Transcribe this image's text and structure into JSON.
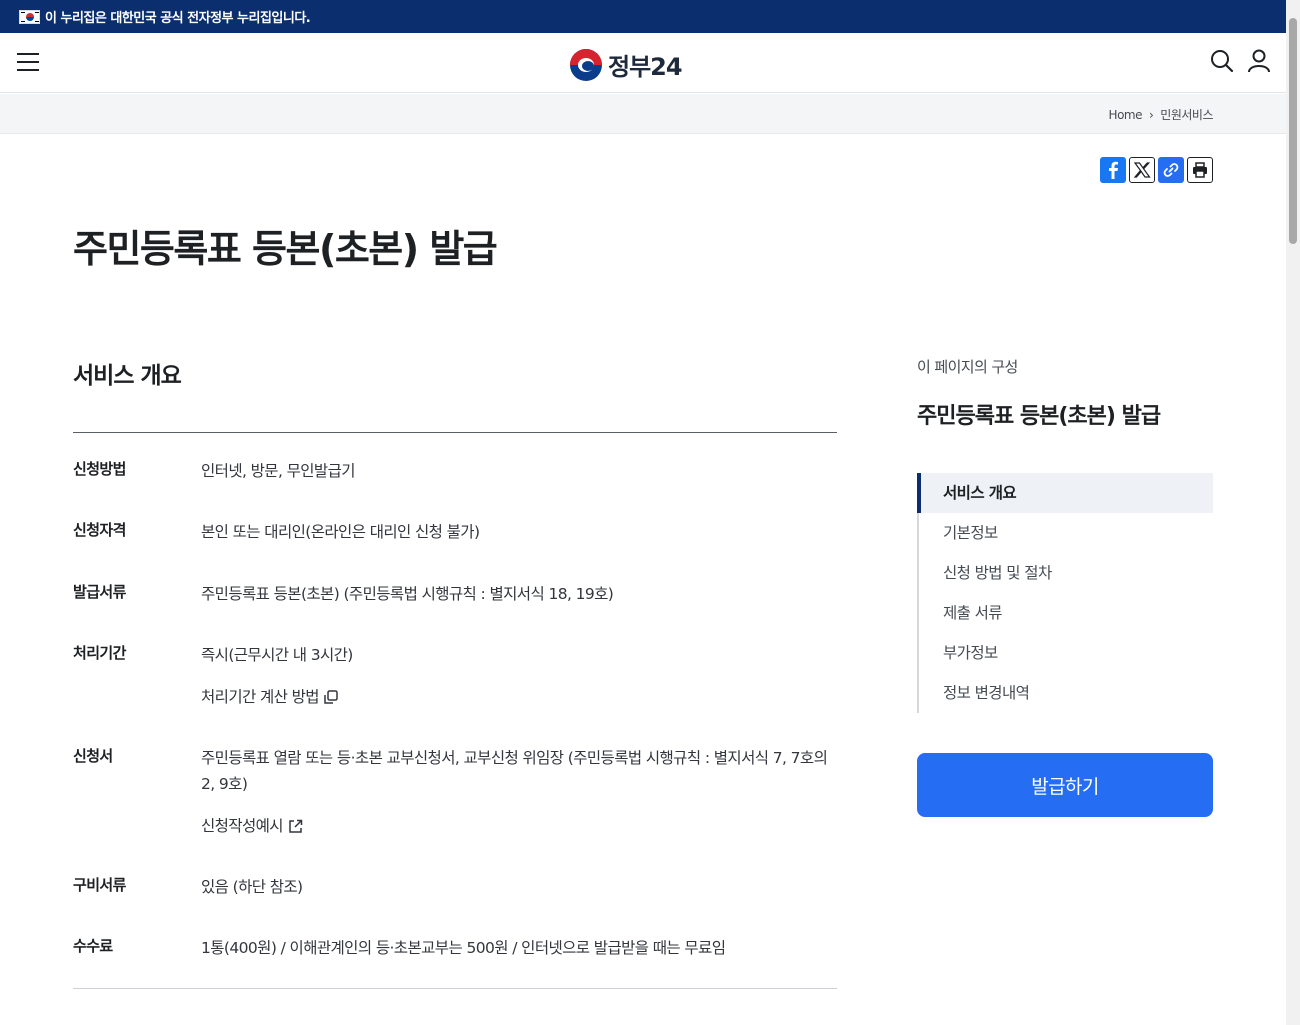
{
  "banner": {
    "text": "이 누리집은 대한민국 공식 전자정부 누리집입니다."
  },
  "header": {
    "logo_text": "정부24"
  },
  "breadcrumb": {
    "home": "Home",
    "separator": "›",
    "current": "민원서비스"
  },
  "page": {
    "title": "주민등록표 등본(초본) 발급"
  },
  "overview": {
    "title": "서비스 개요",
    "rows": [
      {
        "label": "신청방법",
        "values": [
          "인터넷, 방문, 무인발급기"
        ]
      },
      {
        "label": "신청자격",
        "values": [
          "본인 또는 대리인(온라인은 대리인 신청 불가)"
        ]
      },
      {
        "label": "발급서류",
        "values": [
          "주민등록표 등본(초본) (주민등록법 시행규칙 : 별지서식 18, 19호)"
        ]
      },
      {
        "label": "처리기간",
        "values": [
          "즉시(근무시간 내 3시간)"
        ],
        "link": "처리기간 계산 방법"
      },
      {
        "label": "신청서",
        "values": [
          "주민등록표 열람 또는 등·초본 교부신청서, 교부신청 위임장 (주민등록법 시행규칙 : 별지서식 7, 7호의2, 9호)"
        ],
        "link": "신청작성예시"
      },
      {
        "label": "구비서류",
        "values": [
          "있음 (하단 참조)"
        ]
      },
      {
        "label": "수수료",
        "values": [
          "1통(400원) / 이해관계인의 등·초본교부는 500원 / 인터넷으로 발급받을 때는 무료임"
        ]
      }
    ]
  },
  "toc": {
    "caption": "이 페이지의 구성",
    "title": "주민등록표 등본(초본) 발급",
    "items": [
      "서비스 개요",
      "기본정보",
      "신청 방법 및 절차",
      "제출 서류",
      "부가정보",
      "정보 변경내역"
    ],
    "active_index": 0
  },
  "actions": {
    "issue_label": "발급하기"
  },
  "colors": {
    "banner": "#0b2e6e",
    "primary": "#256ef4",
    "text": "#1e2124"
  }
}
